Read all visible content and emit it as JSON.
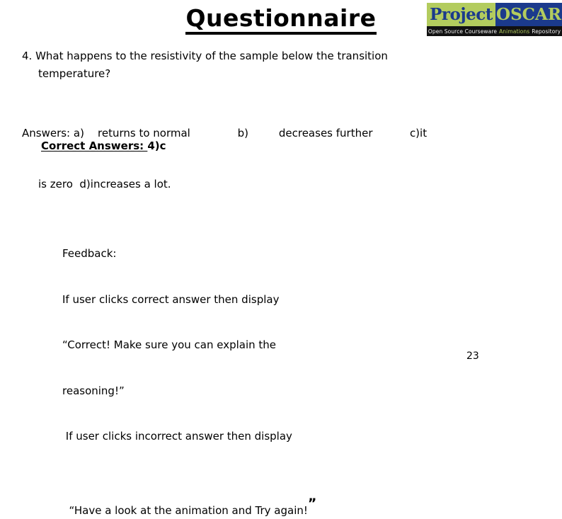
{
  "slide": {
    "title": "Questionnaire",
    "page_number": "23"
  },
  "logo": {
    "name": "project-oscar-logo",
    "word_left": "Project",
    "word_right": "OSCAR",
    "tagline_parts": [
      {
        "text": "Open Source Courseware",
        "color": "#f2f2f2"
      },
      {
        "text": "Animations",
        "color": "#b3cc5e"
      },
      {
        "text": "Repository",
        "color": "#f2f2f2"
      }
    ],
    "colors": {
      "left_background": "#b3cc5e",
      "right_background": "#1b3a8c",
      "left_text": "#1b3a8c",
      "right_text": "#b3cc5e",
      "tagline_background": "#111111"
    }
  },
  "question": {
    "number": "4.",
    "line1": "4.  What happens to the resistivity of the sample below the transition",
    "line2": "temperature?"
  },
  "answers": {
    "line1": "Answers: a)    returns to normal              b)         decreases further           c)it",
    "line2": "is zero  d)increases a lot.",
    "options": [
      {
        "key": "a)",
        "text": "returns to normal"
      },
      {
        "key": "b)",
        "text": "decreases further"
      },
      {
        "key": "c)",
        "text": "it is zero"
      },
      {
        "key": "d)",
        "text": "increases a lot."
      }
    ]
  },
  "correct_answers": {
    "label": "Correct Answers: ",
    "value": "4)c"
  },
  "feedback": {
    "heading": "Feedback:",
    "line_correct_intro": "If user clicks correct answer then display",
    "line_correct_msg1": "“Correct! Make sure you can explain the",
    "line_correct_msg2": "reasoning!”",
    "line_incorrect_intro": " If user clicks incorrect answer then display",
    "line_incorrect_msg": "“Have a look at the animation and Try again!",
    "closing_quote": "”"
  }
}
